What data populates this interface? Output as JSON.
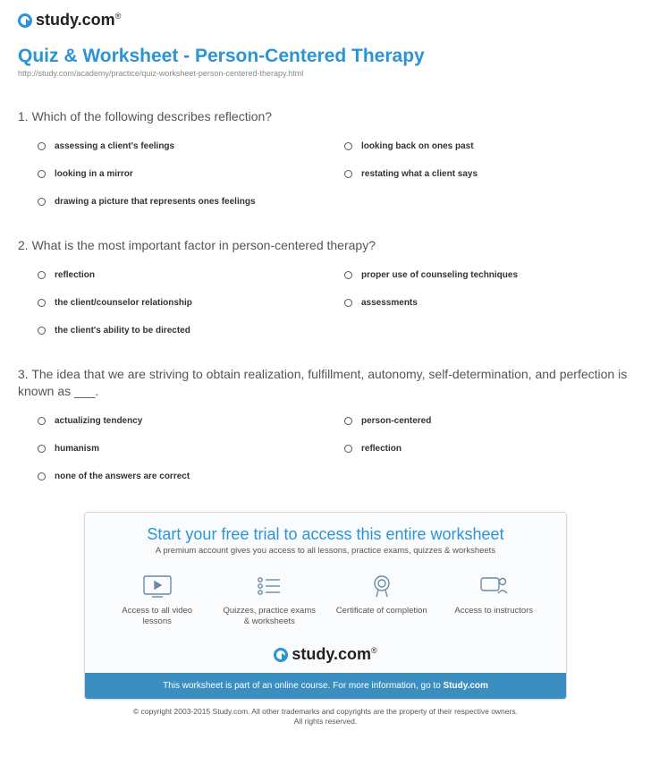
{
  "logo_text": "study.com",
  "title": "Quiz & Worksheet - Person-Centered Therapy",
  "url": "http://study.com/academy/practice/quiz-worksheet-person-centered-therapy.html",
  "questions": [
    {
      "number": "1.",
      "text": "Which of the following describes reflection?",
      "options_left": [
        "assessing a client's feelings",
        "looking in a mirror",
        "drawing a picture that represents ones feelings"
      ],
      "options_right": [
        "looking back on ones past",
        "restating what a client says"
      ]
    },
    {
      "number": "2.",
      "text": "What is the most important factor in person-centered therapy?",
      "options_left": [
        "reflection",
        "the client/counselor relationship",
        "the client's ability to be directed"
      ],
      "options_right": [
        "proper use of counseling techniques",
        "assessments"
      ]
    },
    {
      "number": "3.",
      "text": "The idea that we are striving to obtain realization, fulfillment, autonomy, self-determination, and perfection is known as ___.",
      "options_left": [
        "actualizing tendency",
        "humanism",
        "none of the answers are correct"
      ],
      "options_right": [
        "person-centered",
        "reflection"
      ]
    }
  ],
  "cta": {
    "title": "Start your free trial to access this entire worksheet",
    "subtitle": "A premium account gives you access to all lessons, practice exams, quizzes & worksheets",
    "features": [
      "Access to all video lessons",
      "Quizzes, practice exams & worksheets",
      "Certificate of completion",
      "Access to instructors"
    ],
    "logo_text": "study.com",
    "banner_prefix": "This worksheet is part of an online course. For more information, go to ",
    "banner_link": "Study.com"
  },
  "copyright_line1": "© copyright 2003-2015 Study.com. All other trademarks and copyrights are the property of their respective owners.",
  "copyright_line2": "All rights reserved."
}
